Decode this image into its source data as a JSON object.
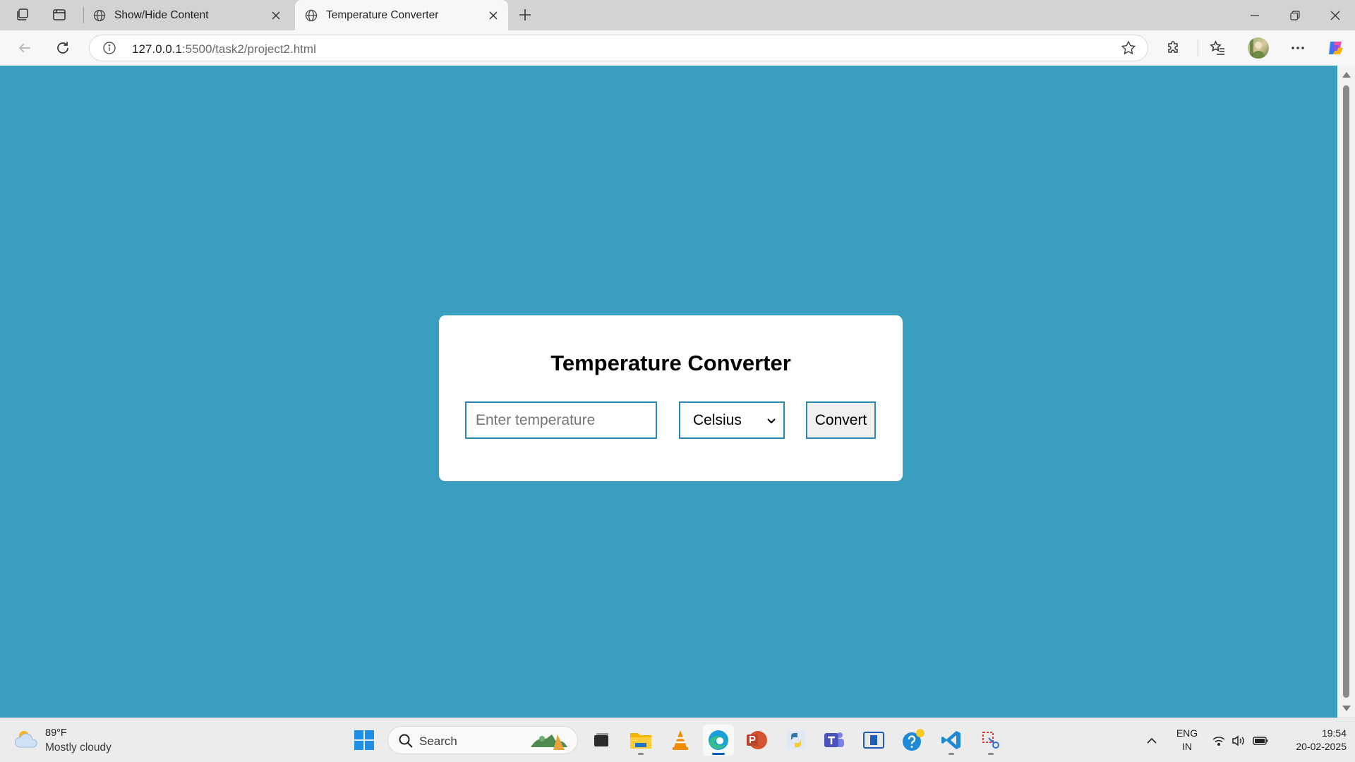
{
  "browser": {
    "tabs": [
      {
        "title": "Show/Hide Content",
        "active": false
      },
      {
        "title": "Temperature Converter",
        "active": true
      }
    ],
    "url_host": "127.0.0.1",
    "url_path": ":5500/task2/project2.html"
  },
  "page": {
    "background_color": "#3a9ebf",
    "title": "Temperature Converter",
    "input_placeholder": "Enter temperature",
    "unit_selected": "Celsius",
    "convert_label": "Convert",
    "accent_border": "#2a8ab5"
  },
  "taskbar": {
    "weather_temp": "89°F",
    "weather_desc": "Mostly cloudy",
    "search_label": "Search",
    "lang_line1": "ENG",
    "lang_line2": "IN",
    "time": "19:54",
    "date": "20-02-2025",
    "apps": [
      "windows-start",
      "search",
      "task-view",
      "file-explorer",
      "vlc",
      "edge",
      "powerpoint",
      "python",
      "teams",
      "app-window",
      "help",
      "vscode",
      "snipping-tool"
    ]
  }
}
